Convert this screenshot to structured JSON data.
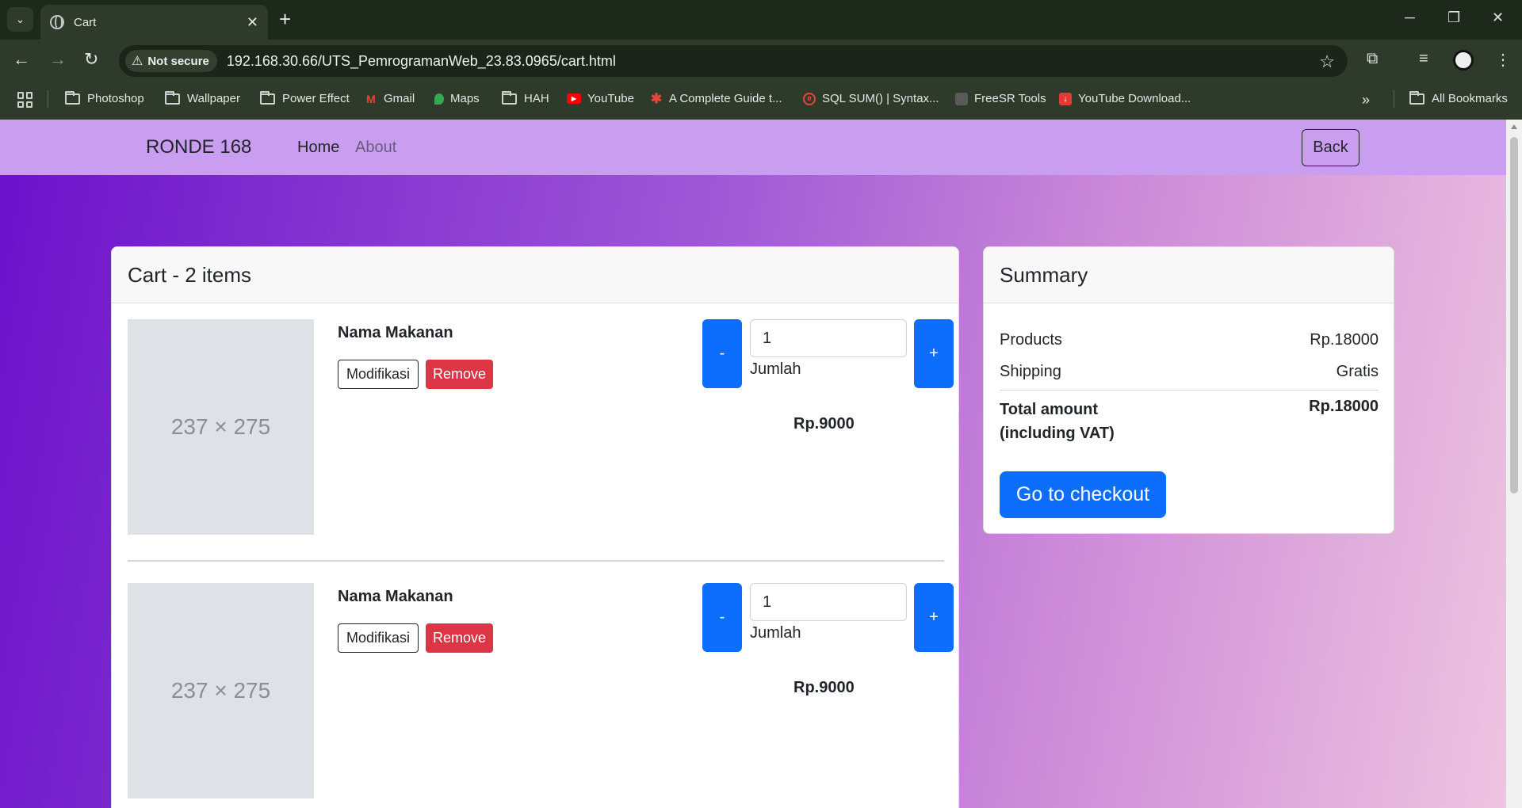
{
  "browser": {
    "tab_title": "Cart",
    "security_label": "Not secure",
    "url": "192.168.30.66/UTS_PemrogramanWeb_23.83.0965/cart.html",
    "bookmarks": [
      "Photoshop",
      "Wallpaper",
      "Power Effect",
      "Gmail",
      "Maps",
      "HAH",
      "YouTube",
      "A Complete Guide t...",
      "SQL SUM() | Syntax...",
      "FreeSR Tools",
      "YouTube Download..."
    ],
    "all_bookmarks": "All Bookmarks"
  },
  "navbar": {
    "brand": "RONDE 168",
    "links": [
      "Home",
      "About"
    ],
    "back": "Back"
  },
  "cart": {
    "title": "Cart - 2 items",
    "items": [
      {
        "image": "237 × 275",
        "name": "Nama Makanan",
        "modify": "Modifikasi",
        "remove": "Remove",
        "minus": "-",
        "plus": "+",
        "quantity": "1",
        "quantity_label": "Jumlah",
        "price": "Rp.9000"
      },
      {
        "image": "237 × 275",
        "name": "Nama Makanan",
        "modify": "Modifikasi",
        "remove": "Remove",
        "minus": "-",
        "plus": "+",
        "quantity": "1",
        "quantity_label": "Jumlah",
        "price": "Rp.9000"
      }
    ]
  },
  "summary": {
    "title": "Summary",
    "products_label": "Products",
    "products_value": "Rp.18000",
    "shipping_label": "Shipping",
    "shipping_value": "Gratis",
    "total_label": "Total amount (including VAT)",
    "total_value": "Rp.18000",
    "checkout": "Go to checkout"
  },
  "colors": {
    "primary": "#0d6efd",
    "danger": "#dc3545",
    "navbar": "#c99ef0",
    "gradient_start": "#6a11cb",
    "gradient_end": "#eec4e0"
  }
}
